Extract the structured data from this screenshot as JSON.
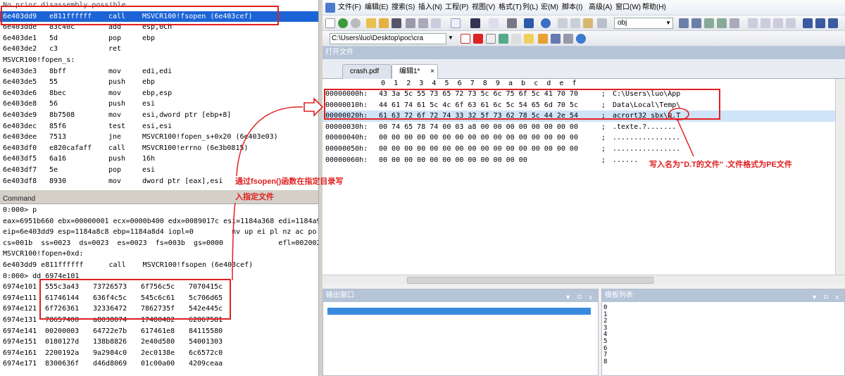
{
  "disasm": {
    "first_line": "No prior disassembly possible",
    "lines": [
      {
        "addr": "6e403dd9",
        "bytes": "e811ffffff",
        "mn": "call",
        "op": "MSVCR100!fsopen (6e403cef)"
      },
      {
        "addr": "6e403dde",
        "bytes": "83c40c",
        "mn": "add",
        "op": "esp,0Ch"
      },
      {
        "addr": "6e403de1",
        "bytes": "5d",
        "mn": "pop",
        "op": "ebp"
      },
      {
        "addr": "6e403de2",
        "bytes": "c3",
        "mn": "ret",
        "op": ""
      },
      {
        "label": "MSVCR100!fopen_s:"
      },
      {
        "addr": "6e403de3",
        "bytes": "8bff",
        "mn": "mov",
        "op": "edi,edi"
      },
      {
        "addr": "6e403de5",
        "bytes": "55",
        "mn": "push",
        "op": "ebp"
      },
      {
        "addr": "6e403de6",
        "bytes": "8bec",
        "mn": "mov",
        "op": "ebp,esp"
      },
      {
        "addr": "6e403de8",
        "bytes": "56",
        "mn": "push",
        "op": "esi"
      },
      {
        "addr": "6e403de9",
        "bytes": "8b7508",
        "mn": "mov",
        "op": "esi,dword ptr [ebp+8]"
      },
      {
        "addr": "6e403dec",
        "bytes": "85f6",
        "mn": "test",
        "op": "esi,esi"
      },
      {
        "addr": "6e403dee",
        "bytes": "7513",
        "mn": "jne",
        "op": "MSVCR100!fopen_s+0x20 (6e403e03)"
      },
      {
        "addr": "6e403df0",
        "bytes": "e820cafaff",
        "mn": "call",
        "op": "MSVCR100!errno (6e3b0815)"
      },
      {
        "addr": "6e403df5",
        "bytes": "6a16",
        "mn": "push",
        "op": "16h"
      },
      {
        "addr": "6e403df7",
        "bytes": "5e",
        "mn": "pop",
        "op": "esi"
      },
      {
        "addr": "6e403df8",
        "bytes": "8930",
        "mn": "mov",
        "op": "dword ptr [eax],esi"
      }
    ]
  },
  "command": {
    "title": "Command",
    "lines": [
      "0:000> p",
      "eax=6951b660 ebx=00000001 ecx=0000b400 edx=0089017c esi=1184a368 edi=1184a9",
      "eip=6e403dd9 esp=1184a8c8 ebp=1184a8d4 iopl=0         nv up ei pl nz ac po",
      "cs=001b  ss=0023  ds=0023  es=0023  fs=003b  gs=0000             efl=002002",
      "MSVCR100!fopen+0xd:",
      "6e403dd9 e811ffffff      call    MSVCR100!fsopen (6e403cef)",
      "0:000> dd 6974e101"
    ],
    "dump": [
      [
        "6974e101",
        "555c3a43",
        "73726573",
        "6f756c5c",
        "7070415c"
      ],
      [
        "6974e111",
        "61746144",
        "636f4c5c",
        "545c6c61",
        "5c706d65"
      ],
      [
        "6974e121",
        "6f726361",
        "32336472",
        "7862735f",
        "542e445c"
      ],
      [
        "6974e131",
        "78657400",
        "a8038074",
        "17480482",
        "62067581"
      ],
      [
        "6974e141",
        "00200003",
        "64722e7b",
        "617461e8",
        "84115580"
      ],
      [
        "6974e151",
        "0180127d",
        "138b8826",
        "2e40d580",
        "54001303"
      ],
      [
        "6974e161",
        "2200192a",
        "9a2984c0",
        "2ec0138e",
        "6c6572c0"
      ],
      [
        "6974e171",
        "8300636f",
        "d46d8069",
        "01c00a00",
        "4209ceaa"
      ]
    ]
  },
  "editor": {
    "menu": [
      "文件(F)",
      "编辑(E)",
      "搜索(S)",
      "插入(N)",
      "工程(P)",
      "视图(V)",
      "格式(T)",
      "列(L)",
      "宏(M)",
      "脚本(I)",
      "高级(A)",
      "窗口(W)",
      "帮助(H)"
    ],
    "search_value": "obj",
    "path": "C:\\Users\\luo\\Desktop\\poc\\cra",
    "open_files_label": "打开文件",
    "tabs": [
      "crash.pdf",
      "编辑1*"
    ],
    "tab_close": "×",
    "hex_header": [
      "0",
      "1",
      "2",
      "3",
      "4",
      "5",
      "6",
      "7",
      "8",
      "9",
      "a",
      "b",
      "c",
      "d",
      "e",
      "f"
    ],
    "hex_rows": [
      {
        "off": "00000000h:",
        "hex": "43 3a 5c 55 73 65 72 73 5c 6c 75 6f 5c 41 70 70",
        "sep": ";",
        "ascii": "C:\\Users\\luo\\App"
      },
      {
        "off": "00000010h:",
        "hex": "44 61 74 61 5c 4c 6f 63 61 6c 5c 54 65 6d 70 5c",
        "sep": ";",
        "ascii": "Data\\Local\\Temp\\"
      },
      {
        "off": "00000020h:",
        "hex": "61 63 72 6f 72 74 33 32 5f 73 62 78 5c 44 2e 54",
        "sep": ";",
        "ascii": "acrort32_sbx\\D.T"
      },
      {
        "off": "00000030h:",
        "hex": "00 74 65 78 74 00 03 a8 00 00 00 00 00 00 00 00",
        "sep": ";",
        "ascii": ".texte.?......."
      },
      {
        "off": "00000040h:",
        "hex": "00 00 00 00 00 00 00 00 00 00 00 00 00 00 00 00",
        "sep": ";",
        "ascii": "................"
      },
      {
        "off": "00000050h:",
        "hex": "00 00 00 00 00 00 00 00 00 00 00 00 00 00 00 00",
        "sep": ";",
        "ascii": "................"
      },
      {
        "off": "00000060h:",
        "hex": "00 00 00 00 00 00 00 00 00 00 00 00",
        "sep": ";",
        "ascii": "......"
      }
    ],
    "output_title": "输出窗口",
    "template_title": "模板列表",
    "pin": "ㅁ",
    "close": "x",
    "template_numbers": [
      "0",
      "1",
      "2",
      "3",
      "4",
      "5",
      "6",
      "7",
      "8"
    ]
  },
  "annotations": {
    "left_line1": "通过fsopen()函数在指定目录写",
    "left_line2": "入指定文件",
    "right": "写入名为\"D.T的文件\" .文件格式为PE文件"
  },
  "colors": {
    "annotation": "#e02020",
    "selection": "#1c64d6"
  }
}
